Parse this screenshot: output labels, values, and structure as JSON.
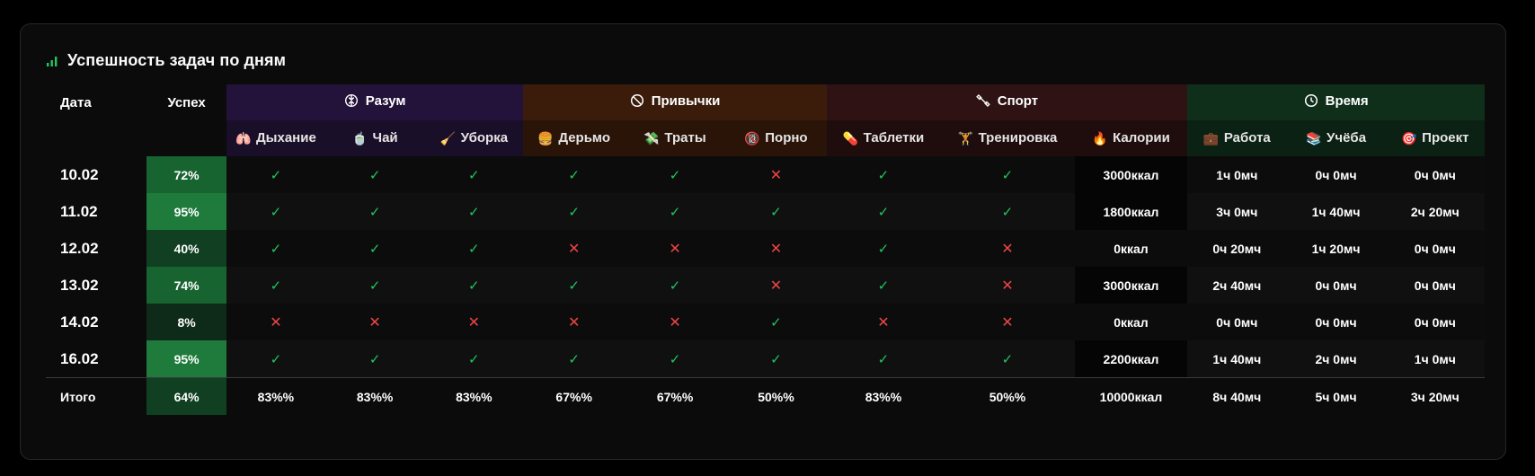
{
  "title": "Успешность задач по дням",
  "headers": {
    "date": "Дата",
    "success": "Успех",
    "groups": [
      {
        "label": "Разум",
        "icon": "brain-icon"
      },
      {
        "label": "Привычки",
        "icon": "ban-icon"
      },
      {
        "label": "Спорт",
        "icon": "dumbbell-icon"
      },
      {
        "label": "Время",
        "icon": "clock-icon"
      }
    ],
    "sub": [
      {
        "label": "Дыхание",
        "emoji": "🫁"
      },
      {
        "label": "Чай",
        "emoji": "🍵"
      },
      {
        "label": "Уборка",
        "emoji": "🧹"
      },
      {
        "label": "Дерьмо",
        "emoji": "🍔"
      },
      {
        "label": "Траты",
        "emoji": "💸"
      },
      {
        "label": "Порно",
        "emoji": "🔞"
      },
      {
        "label": "Таблетки",
        "emoji": "💊"
      },
      {
        "label": "Тренировка",
        "emoji": "🏋"
      },
      {
        "label": "Калории",
        "emoji": "🔥"
      },
      {
        "label": "Работа",
        "emoji": "💼"
      },
      {
        "label": "Учёба",
        "emoji": "📚"
      },
      {
        "label": "Проект",
        "emoji": "🎯"
      }
    ]
  },
  "rows": [
    {
      "date": "10.02",
      "success": "72%",
      "success_pct": 72,
      "checks": [
        1,
        1,
        1,
        1,
        1,
        0,
        1,
        1
      ],
      "calories": "3000ккал",
      "work": "1ч 0мч",
      "study": "0ч 0мч",
      "project": "0ч 0мч"
    },
    {
      "date": "11.02",
      "success": "95%",
      "success_pct": 95,
      "checks": [
        1,
        1,
        1,
        1,
        1,
        1,
        1,
        1
      ],
      "calories": "1800ккал",
      "work": "3ч 0мч",
      "study": "1ч 40мч",
      "project": "2ч 20мч"
    },
    {
      "date": "12.02",
      "success": "40%",
      "success_pct": 40,
      "checks": [
        1,
        1,
        1,
        0,
        0,
        0,
        1,
        0
      ],
      "calories": "0ккал",
      "work": "0ч 20мч",
      "study": "1ч 20мч",
      "project": "0ч 0мч"
    },
    {
      "date": "13.02",
      "success": "74%",
      "success_pct": 74,
      "checks": [
        1,
        1,
        1,
        1,
        1,
        0,
        1,
        0
      ],
      "calories": "3000ккал",
      "work": "2ч 40мч",
      "study": "0ч 0мч",
      "project": "0ч 0мч"
    },
    {
      "date": "14.02",
      "success": "8%",
      "success_pct": 8,
      "checks": [
        0,
        0,
        0,
        0,
        0,
        1,
        0,
        0
      ],
      "calories": "0ккал",
      "work": "0ч 0мч",
      "study": "0ч 0мч",
      "project": "0ч 0мч"
    },
    {
      "date": "16.02",
      "success": "95%",
      "success_pct": 95,
      "checks": [
        1,
        1,
        1,
        1,
        1,
        1,
        1,
        1
      ],
      "calories": "2200ккал",
      "work": "1ч 40мч",
      "study": "2ч 0мч",
      "project": "1ч 0мч"
    }
  ],
  "totals": {
    "label": "Итого",
    "success": "64%",
    "success_pct": 64,
    "values": [
      "83%%",
      "83%%",
      "83%%",
      "67%%",
      "67%%",
      "50%%",
      "83%%",
      "50%%"
    ],
    "calories": "10000ккал",
    "work": "8ч 40мч",
    "study": "5ч 0мч",
    "project": "3ч 20мч"
  },
  "colors": {
    "check": "#22c55e",
    "cross": "#ef4444",
    "success_high": "#1e7b3c",
    "success_mid": "#176430",
    "success_low": "#103f21",
    "success_vlow": "#0e2a18"
  }
}
